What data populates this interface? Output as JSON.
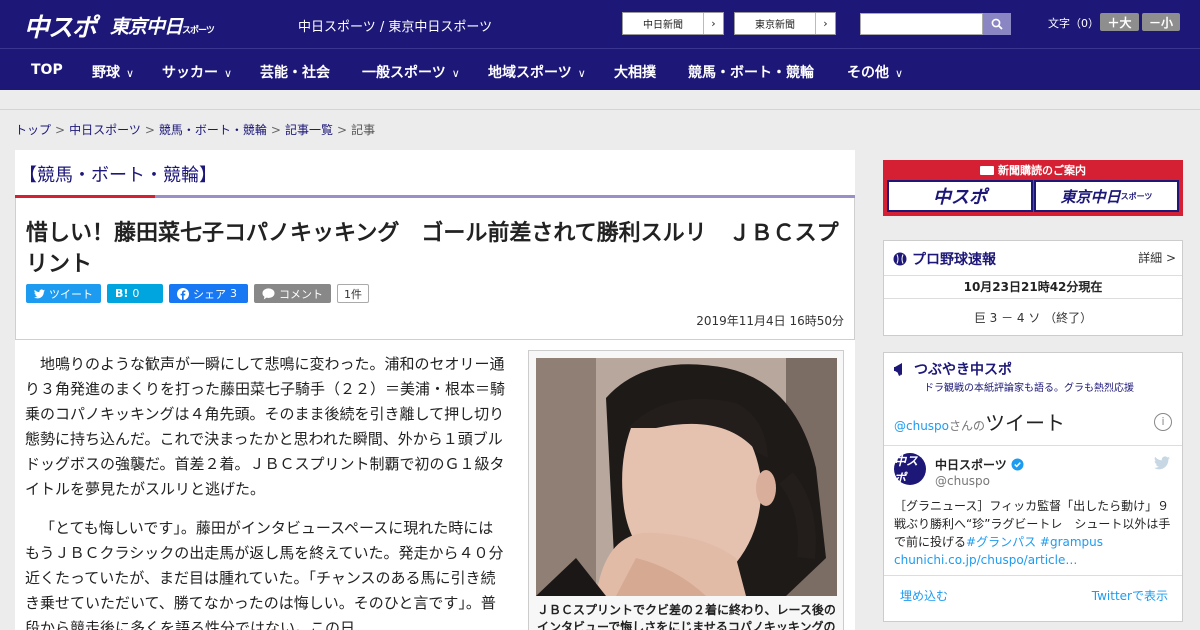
{
  "header": {
    "logo_chuspo": "中スポ",
    "logo_tokyo": "東京中日",
    "logo_tokyo_suffix": "スポーツ",
    "site_title": "中日スポーツ / 東京中日スポーツ",
    "btn_chunichi": "中日新聞",
    "btn_tokyo": "東京新聞",
    "font_label": "文字（0）",
    "font_bigger": "＋大",
    "font_smaller": "－小"
  },
  "nav": {
    "items": [
      "TOP",
      "野球",
      "サッカー",
      "芸能・社会",
      "一般スポーツ",
      "地域スポーツ",
      "大相撲",
      "競馬・ボート・競輪",
      "その他"
    ]
  },
  "breadcrumb": {
    "items": [
      "トップ",
      "中日スポーツ",
      "競馬・ボート・競輪",
      "記事一覧"
    ],
    "current": "記事"
  },
  "article": {
    "category": "【競馬・ボート・競輪】",
    "headline": "惜しい！藤田菜七子コパノキッキング　ゴール前差されて勝利スルリ　ＪＢＣスプリント",
    "share": {
      "tweet": "ツイート",
      "hatena": "B!",
      "hatena_count": "0",
      "facebook": "シェア",
      "facebook_count": "3",
      "comment": "コメント",
      "comment_count": "1件"
    },
    "pubdate": "2019年11月4日 16時50分",
    "paragraphs": [
      "地鳴りのような歓声が一瞬にして悲鳴に変わった。浦和のセオリー通り３角発進のまくりを打った藤田菜七子騎手（２２）＝美浦・根本＝騎乗のコパノキッキングは４角先頭。そのまま後続を引き離して押し切り態勢に持ち込んだ。これで決まったかと思われた瞬間、外から１頭ブルドッグボスの強襲だ。首差２着。ＪＢＣスプリント制覇で初のＧ１級タイトルを夢見たがスルリと逃げた。",
      "「とても悔しいです」。藤田がインタビュースペースに現れた時にはもうＪＢＣクラシックの出走馬が返し馬を終えていた。発走から４０分近くたっていたが、まだ目は腫れていた。「チャンスのある馬に引き続き乗せていただいて、勝てなかったのは悔しい。そのひと言です」。普段から競走後に多くを語る性分ではない。この日"
    ],
    "photo_caption": "ＪＢＣスプリントでクビ差の２着に終わり、レース後のインタビューで悔しさをにじませるコパノキッキングの"
  },
  "sidebar": {
    "promo_title": "新聞購読のご案内",
    "promo_chuspo": "中スポ",
    "promo_tokyo": "東京中日",
    "promo_tokyo_suffix": "スポーツ",
    "baseball_title": "プロ野球速報",
    "baseball_detail": "詳細 >",
    "baseball_time": "10月23日21時42分現在",
    "baseball_score": "巨 3 － 4 ソ （終了）",
    "tweets_title": "つぶやき中スポ",
    "tweets_sub": "ドラ観戦の本紙評論家も語る。グラも熱烈応援",
    "tweets_handle_link": "@chuspo",
    "tweets_san": "さんの",
    "tweets_big": "ツイート",
    "tweet_name": "中日スポーツ",
    "tweet_handle": "@chuspo",
    "tweet_avatar": "中スポ",
    "tweet_text_1": "［グラニュース］フィッカ監督「出したら動け」９戦ぶり勝利へ“珍”ラグビートレ　シュート以外は手で前に投げる",
    "tweet_tag_1": "#グランパス",
    "tweet_tag_2": "#grampus",
    "tweet_link": "chunichi.co.jp/chuspo/article…",
    "tweet_embed": "埋め込む",
    "tweet_view": "Twitterで表示"
  },
  "colors": {
    "brand": "#1d1878",
    "accent_red": "#d42032",
    "twitter": "#1d9bf0"
  }
}
